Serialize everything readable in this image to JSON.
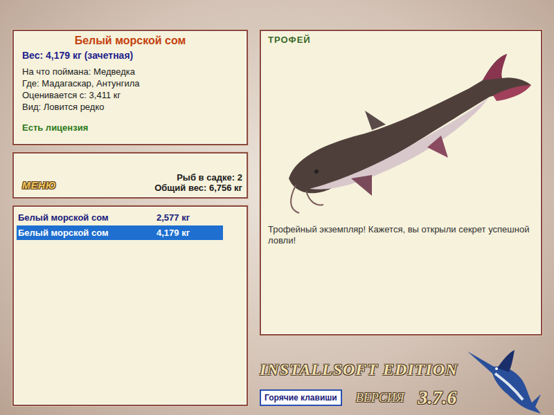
{
  "fish": {
    "name": "Белый морской сом",
    "weight": "Вес: 4,179 кг (зачетная)",
    "bait": "На что поймана: Медведка",
    "place": "Где: Мадагаскар, Антунгила",
    "rated_from": "Оценивается с: 3,411 кг",
    "kind": "Вид: Ловится редко",
    "license": "Есть лицензия"
  },
  "menu_button": "МЕНЮ",
  "keepnet": {
    "count": "Рыб в садке: 2",
    "total": "Общий вес: 6,756 кг"
  },
  "catch_list": [
    {
      "name": "Белый морской сом",
      "weight": "2,577 кг",
      "selected": false
    },
    {
      "name": "Белый морской сом",
      "weight": "4,179 кг",
      "selected": true
    }
  ],
  "trophy": {
    "badge": "ТРОФЕЙ",
    "message": "Трофейный экземпляр! Кажется, вы открыли секрет успешной ловли!"
  },
  "hotkeys_button": "Горячие клавиши",
  "brand": {
    "edition": "INSTALLSOFT EDITION",
    "version_label": "ВЕРСИЯ",
    "version": "3.7.6"
  }
}
